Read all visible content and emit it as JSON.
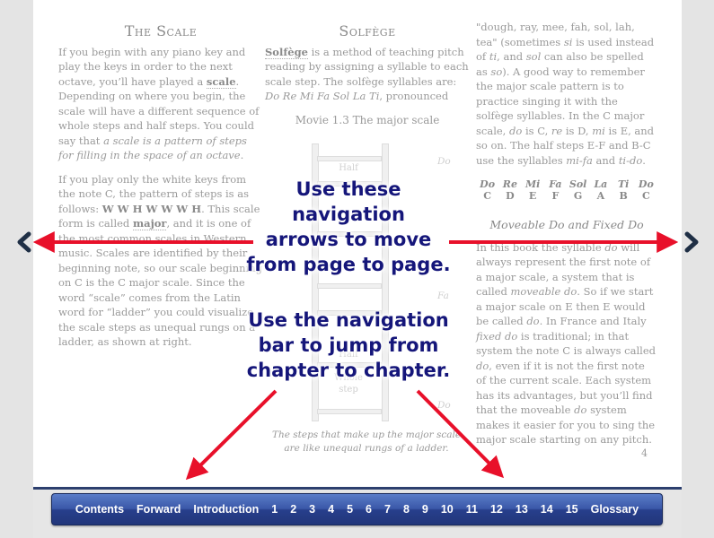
{
  "colors": {
    "navbar": "#2c4590",
    "arrow": "#e8102a",
    "overlay_text": "#15167a",
    "text": "#9a9a9a"
  },
  "col1": {
    "title": "The Scale",
    "p1_a": "If you begin with any piano key and play the keys in order to the next octave, you’ll have played a ",
    "p1_kw": "scale",
    "p1_b": ". Depending on where you begin, the scale will have a different sequence of whole steps and half steps. You could say that ",
    "p1_it": "a scale is a pattern of steps for filling in the space of an octave",
    "p1_c": ".",
    "p2_a": "If you play only the white keys from the note C, the pattern of steps is as follows: ",
    "p2_bold": "W W H W W W H",
    "p2_b": ". This scale form is called ",
    "p2_kw": "major",
    "p2_c": ", and it is one of the most common scales in Western music. Scales are identified by their beginning note, so our scale beginning on C is the C major scale. Since the word “scale” comes from the Latin word for “ladder” you could visualize the scale steps as unequal rungs on a ladder, as shown at right."
  },
  "col2": {
    "title": "Solfège",
    "p1_kw": "Solfège",
    "p1_a": " is a method of teaching pitch reading by assigning a syllable to each scale step. The solfège syllables are: ",
    "p1_it": "Do Re Mi Fa Sol La Ti",
    "p1_b": ", pronounced",
    "movie_title": "Movie 1.3  The major scale",
    "ladder": {
      "half_top": "Half",
      "do_top": "Do",
      "fa": "Fa",
      "half_bottom": "Half",
      "whole": "Whole",
      "step": "step",
      "do_bottom": "Do"
    },
    "caption": "The steps that make up the major scale are like unequal rungs of a ladder."
  },
  "col3": {
    "p1_a": "\"dough, ray, mee, fah, sol, lah, tea\" (sometimes ",
    "p1_it1": "si",
    "p1_b": " is used instead of ",
    "p1_it2": "ti",
    "p1_c": ", and ",
    "p1_it3": "sol",
    "p1_d": " can also be spelled as ",
    "p1_it4": "so",
    "p1_e": "). A good way to remember the major scale pattern is to practice singing it with the solfège syllables. In the C major scale, ",
    "p1_it5": "do",
    "p1_f": " is C, ",
    "p1_it6": "re",
    "p1_g": " is D, ",
    "p1_it7": "mi",
    "p1_h": " is E, and so on. The half steps E-F and B-C use the syllables ",
    "p1_it8": "mi-fa",
    "p1_i": " and ",
    "p1_it9": "ti-do",
    "p1_j": ".",
    "syllables": [
      "Do",
      "Re",
      "Mi",
      "Fa",
      "Sol",
      "La",
      "Ti",
      "Do"
    ],
    "notes": [
      "C",
      "D",
      "E",
      "F",
      "G",
      "A",
      "B",
      "C"
    ],
    "subhead": "Moveable Do and Fixed Do",
    "p2_a": "In this book the syllable ",
    "p2_it1": "do",
    "p2_b": " will always represent the first note of a major scale, a system that is called ",
    "p2_it2": "moveable do",
    "p2_c": ". So if we start a major scale on E then E would be called ",
    "p2_it3": "do",
    "p2_d": ". In France and Italy ",
    "p2_it4": "fixed do",
    "p2_e": " is traditional; in that system the note C is always called ",
    "p2_it5": "do",
    "p2_f": ", even if it is not the first note of the current scale. Each system has its advantages, but you’ll find that the moveable ",
    "p2_it6": "do",
    "p2_g": " system makes it easier for you to sing the major scale starting on any pitch.",
    "page_number": "4"
  },
  "overlay": {
    "line1": "Use these",
    "line2": "navigation",
    "line3": "arrows to move",
    "line4": "from page to page.",
    "line5": "Use the navigation",
    "line6": "bar to jump from",
    "line7": "chapter to chapter."
  },
  "nav_icons": {
    "prev": "chevron-left-icon",
    "next": "chevron-right-icon"
  },
  "navbar": {
    "items": [
      "Contents",
      "Forward",
      "Introduction",
      "1",
      "2",
      "3",
      "4",
      "5",
      "6",
      "7",
      "8",
      "9",
      "10",
      "11",
      "12",
      "13",
      "14",
      "15",
      "Glossary"
    ]
  }
}
